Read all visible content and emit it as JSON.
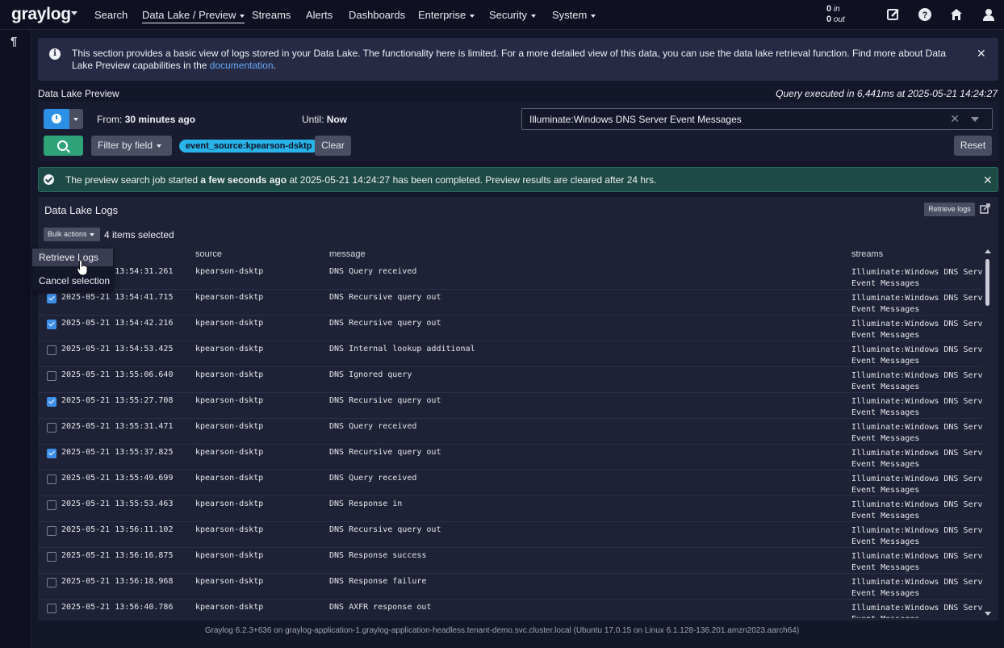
{
  "nav": {
    "brand": "graylog",
    "items": [
      {
        "label": "Search",
        "dropdown": false
      },
      {
        "label": "Data Lake / Preview",
        "dropdown": true
      },
      {
        "label": "Streams",
        "dropdown": false
      },
      {
        "label": "Alerts",
        "dropdown": false
      },
      {
        "label": "Dashboards",
        "dropdown": false
      },
      {
        "label": "Enterprise",
        "dropdown": true
      },
      {
        "label": "Security",
        "dropdown": true
      },
      {
        "label": "System",
        "dropdown": true
      }
    ],
    "throughput": {
      "in_value": "0",
      "in_label": "in",
      "out_value": "0",
      "out_label": "out"
    },
    "icons": [
      "edit-icon",
      "help-icon",
      "home-icon",
      "user-icon"
    ]
  },
  "sidebar": {
    "icon": "pilcrow-icon",
    "glyph": "¶"
  },
  "info_banner": {
    "text": "This section provides a basic view of logs stored in your Data Lake. The functionality here is limited. For a more detailed view of this data, you can use the data lake retrieval function. Find more about Data Lake Preview capabilities in the ",
    "link": "documentation",
    "suffix": "."
  },
  "panel": {
    "title": "Data Lake Preview",
    "query_executed": "Query executed in 6,441ms at 2025-05-21 14:24:27"
  },
  "query": {
    "from_label": "From:",
    "from_value": "30 minutes ago",
    "until_label": "Until:",
    "until_value": "Now",
    "stream_value": "Illuminate:Windows DNS Server Event Messages",
    "filter_button": "Filter by field",
    "filter_chip": "event_source:kpearson-dsktp",
    "clear_button": "Clear",
    "reset_button": "Reset"
  },
  "success": {
    "pre": "The preview search job started ",
    "bold": "a few seconds ago",
    "post": " at 2025-05-21 14:24:27 has been completed. Preview results are cleared after 24 hrs."
  },
  "logs": {
    "title": "Data Lake Logs",
    "retrieve_button": "Retrieve logs",
    "bulk_button": "Bulk actions",
    "items_selected": "4 items selected",
    "columns": {
      "source": "source",
      "message": "message",
      "streams": "streams"
    },
    "dropdown": {
      "retrieve": "Retrieve Logs",
      "cancel": "Cancel selection"
    },
    "rows": [
      {
        "time": "2025-05-21 13:54:31.261",
        "source": "kpearson-dsktp",
        "message": "DNS Query received",
        "checked": true
      },
      {
        "time": "2025-05-21 13:54:41.715",
        "source": "kpearson-dsktp",
        "message": "DNS Recursive query out",
        "checked": true
      },
      {
        "time": "2025-05-21 13:54:42.216",
        "source": "kpearson-dsktp",
        "message": "DNS Recursive query out",
        "checked": true
      },
      {
        "time": "2025-05-21 13:54:53.425",
        "source": "kpearson-dsktp",
        "message": "DNS Internal lookup additional",
        "checked": false
      },
      {
        "time": "2025-05-21 13:55:06.640",
        "source": "kpearson-dsktp",
        "message": "DNS Ignored query",
        "checked": false
      },
      {
        "time": "2025-05-21 13:55:27.708",
        "source": "kpearson-dsktp",
        "message": "DNS Recursive query out",
        "checked": true
      },
      {
        "time": "2025-05-21 13:55:31.471",
        "source": "kpearson-dsktp",
        "message": "DNS Query received",
        "checked": false
      },
      {
        "time": "2025-05-21 13:55:37.825",
        "source": "kpearson-dsktp",
        "message": "DNS Recursive query out",
        "checked": true
      },
      {
        "time": "2025-05-21 13:55:49.699",
        "source": "kpearson-dsktp",
        "message": "DNS Query received",
        "checked": false
      },
      {
        "time": "2025-05-21 13:55:53.463",
        "source": "kpearson-dsktp",
        "message": "DNS Response in",
        "checked": false
      },
      {
        "time": "2025-05-21 13:56:11.102",
        "source": "kpearson-dsktp",
        "message": "DNS Recursive query out",
        "checked": false
      },
      {
        "time": "2025-05-21 13:56:16.875",
        "source": "kpearson-dsktp",
        "message": "DNS Response success",
        "checked": false
      },
      {
        "time": "2025-05-21 13:56:18.968",
        "source": "kpearson-dsktp",
        "message": "DNS Response failure",
        "checked": false
      },
      {
        "time": "2025-05-21 13:56:40.786",
        "source": "kpearson-dsktp",
        "message": "DNS AXFR response out",
        "checked": false
      }
    ],
    "stream_line1": "Illuminate:Windows DNS Server",
    "stream_line2": "Event Messages"
  },
  "footer": "Graylog 6.2.3+636 on graylog-application-1.graylog-application-headless.tenant-demo.svc.cluster.local (Ubuntu 17.0.15 on Linux 6.1.128-136.201.amzn2023.aarch64)",
  "colors": {
    "bg": "#14162a",
    "nav": "#0f1123",
    "accent_blue": "#2c8fe6",
    "search_green": "#2ea37a",
    "chip": "#28b4e8",
    "success_bg": "#1e4a45"
  }
}
